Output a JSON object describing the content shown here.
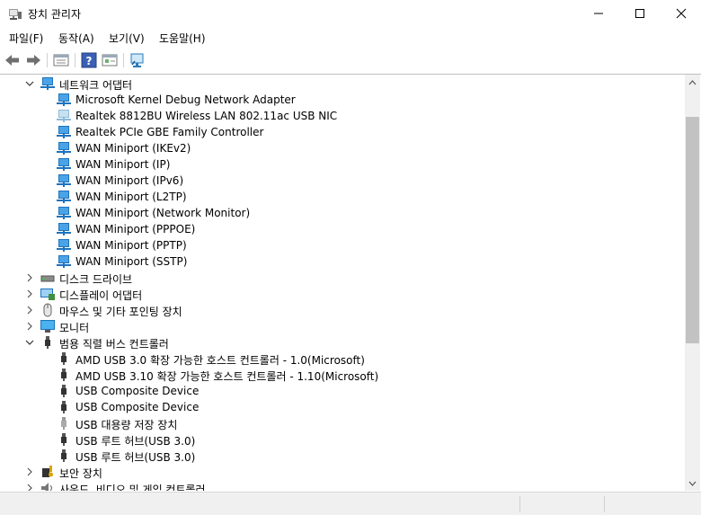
{
  "window": {
    "title": "장치 관리자"
  },
  "menu": [
    {
      "label": "파일(F)"
    },
    {
      "label": "동작(A)"
    },
    {
      "label": "보기(V)"
    },
    {
      "label": "도움말(H)"
    }
  ],
  "toolbar": [
    "back-icon",
    "forward-icon",
    "properties-icon",
    "help-icon",
    "show-hidden-icon",
    "scan-hardware-icon"
  ],
  "tree": {
    "network": {
      "label": "네트워크 어댑터",
      "items": [
        "Microsoft Kernel Debug Network Adapter",
        "Realtek 8812BU Wireless LAN 802.11ac USB NIC",
        "Realtek PCIe GBE Family Controller",
        "WAN Miniport (IKEv2)",
        "WAN Miniport (IP)",
        "WAN Miniport (IPv6)",
        "WAN Miniport (L2TP)",
        "WAN Miniport (Network Monitor)",
        "WAN Miniport (PPPOE)",
        "WAN Miniport (PPTP)",
        "WAN Miniport (SSTP)"
      ]
    },
    "disk_drives": "디스크 드라이브",
    "display_adapters": "디스플레이 어댑터",
    "mice": "마우스 및 기타 포인팅 장치",
    "monitors": "모니터",
    "usb": {
      "label": "범용 직렬 버스 컨트롤러",
      "items": [
        "AMD USB 3.0 확장 가능한 호스트 컨트롤러 - 1.0(Microsoft)",
        "AMD USB 3.10 확장 가능한 호스트 컨트롤러 - 1.10(Microsoft)",
        "USB Composite Device",
        "USB Composite Device",
        "USB 대용량 저장 장치",
        "USB 루트 허브(USB 3.0)",
        "USB 루트 허브(USB 3.0)"
      ]
    },
    "security": "보안 장치",
    "sound": "사운드, 비디오 및 게임 컨트롤러"
  },
  "colors": {
    "accent": "#1e73be",
    "scroll_thumb": "#c2c2c2"
  }
}
